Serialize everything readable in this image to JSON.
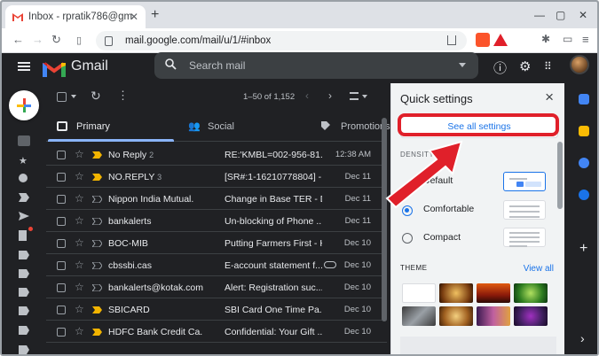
{
  "browser": {
    "tab_title": "Inbox - rpratik786@gmail.c",
    "url": "mail.google.com/mail/u/1/#inbox"
  },
  "gmail": {
    "brand": "Gmail",
    "search_placeholder": "Search mail",
    "pagination": "1–50 of 1,152",
    "tabs": [
      {
        "label": "Primary"
      },
      {
        "label": "Social"
      },
      {
        "label": "Promotions"
      }
    ],
    "emails": [
      {
        "sender": "No Reply",
        "count": "2",
        "subject": "RE:'KMBL=002-956-81...",
        "date": "12:38 AM",
        "important": true,
        "attachment": false
      },
      {
        "sender": "NO.REPLY",
        "count": "3",
        "subject": "[SR#:1-16210778804] - -",
        "date": "Dec 11",
        "important": true,
        "attachment": false
      },
      {
        "sender": "Nippon India Mutual.",
        "count": "",
        "subject": "Change in Base TER - D...",
        "date": "Dec 11",
        "important": false,
        "attachment": false
      },
      {
        "sender": "bankalerts",
        "count": "",
        "subject": "Un-blocking of Phone ...",
        "date": "Dec 11",
        "important": false,
        "attachment": false
      },
      {
        "sender": "BOC-MIB",
        "count": "",
        "subject": "Putting Farmers First - H",
        "date": "Dec 10",
        "important": false,
        "attachment": false
      },
      {
        "sender": "cbssbi.cas",
        "count": "",
        "subject": "E-account statement f...",
        "date": "Dec 10",
        "important": false,
        "attachment": true
      },
      {
        "sender": "bankalerts@kotak.com",
        "count": "",
        "subject": "Alert: Registration suc...",
        "date": "Dec 10",
        "important": false,
        "attachment": false
      },
      {
        "sender": "SBICARD",
        "count": "",
        "subject": "SBI Card One Time Pa...",
        "date": "Dec 10",
        "important": true,
        "attachment": false
      },
      {
        "sender": "HDFC Bank Credit Ca.",
        "count": "",
        "subject": "Confidential: Your Gift ...",
        "date": "Dec 10",
        "important": true,
        "attachment": false
      }
    ]
  },
  "quick_settings": {
    "title": "Quick settings",
    "see_all": "See all settings",
    "density_label": "DENSITY",
    "density_options": [
      {
        "label": "Default",
        "selected": false
      },
      {
        "label": "Comfortable",
        "selected": true
      },
      {
        "label": "Compact",
        "selected": false
      }
    ],
    "theme_label": "THEME",
    "view_all": "View all"
  },
  "colors": {
    "accent": "#1a73e8",
    "highlight": "#e0202a",
    "important": "#f2b400"
  }
}
